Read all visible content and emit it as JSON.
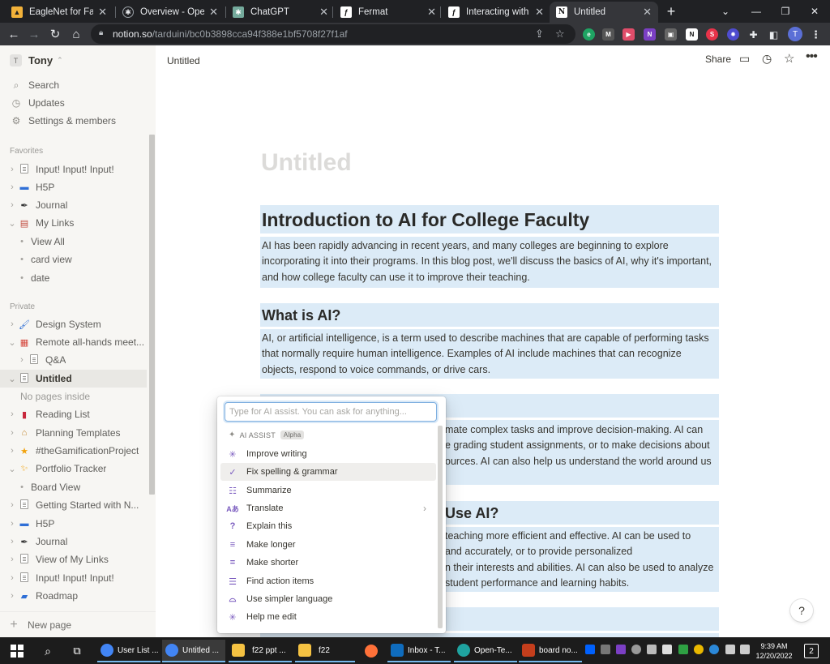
{
  "browser": {
    "tabs": [
      {
        "title": "EagleNet for Facult",
        "icon": "eaglenet-icon",
        "color": "#f2b23a"
      },
      {
        "title": "Overview - OpenAI",
        "icon": "openai-icon",
        "color": "#ffffff"
      },
      {
        "title": "ChatGPT",
        "icon": "chatgpt-icon",
        "color": "#74aa9c"
      },
      {
        "title": "Fermat",
        "icon": "fermat-icon",
        "color": "#ffffff"
      },
      {
        "title": "Interacting with AI",
        "icon": "fermat-icon",
        "color": "#ffffff"
      },
      {
        "title": "Untitled",
        "icon": "notion-icon",
        "color": "#ffffff"
      }
    ],
    "url_host": "notion.so",
    "url_path": "/tarduini/bc0b3898cca94f388e1bf5708f27f1af",
    "profile_initial": "T"
  },
  "sidebar": {
    "workspace_initial": "T",
    "workspace_name": "Tony",
    "top": [
      {
        "label": "Search",
        "icon": "search-icon"
      },
      {
        "label": "Updates",
        "icon": "clock-icon"
      },
      {
        "label": "Settings & members",
        "icon": "gear-icon"
      }
    ],
    "favorites_label": "Favorites",
    "favorites": [
      {
        "label": "Input! Input! Input!",
        "icon": "page-icon",
        "arrow": ">"
      },
      {
        "label": "H5P",
        "icon": "laptop-icon",
        "arrow": ">"
      },
      {
        "label": "Journal",
        "icon": "pen-icon",
        "arrow": ">"
      },
      {
        "label": "My Links",
        "icon": "books-icon",
        "arrow": "v"
      },
      {
        "label": "View All",
        "icon": "bullet",
        "arrow": ""
      },
      {
        "label": "card view",
        "icon": "bullet",
        "arrow": ""
      },
      {
        "label": "date",
        "icon": "bullet",
        "arrow": ""
      }
    ],
    "private_label": "Private",
    "private": [
      {
        "label": "Design System",
        "icon": "paintbrush-icon",
        "arrow": ">"
      },
      {
        "label": "Remote all-hands meet...",
        "icon": "calendar-icon",
        "arrow": "v"
      },
      {
        "label": "Q&A",
        "icon": "page-icon",
        "arrow": ">"
      },
      {
        "label": "Untitled",
        "icon": "page-icon",
        "arrow": "v"
      },
      {
        "label": "No pages inside",
        "icon": "",
        "arrow": ""
      },
      {
        "label": "Reading List",
        "icon": "book-icon",
        "arrow": ">"
      },
      {
        "label": "Planning Templates",
        "icon": "house-icon",
        "arrow": ">"
      },
      {
        "label": "#theGamificationProject",
        "icon": "star-icon",
        "arrow": ">"
      },
      {
        "label": "Portfolio Tracker",
        "icon": "sparkle-icon",
        "arrow": "v"
      },
      {
        "label": "Board View",
        "icon": "bullet",
        "arrow": ""
      },
      {
        "label": "Getting Started with N...",
        "icon": "page-icon",
        "arrow": ">"
      },
      {
        "label": "H5P",
        "icon": "laptop-icon",
        "arrow": ">"
      },
      {
        "label": "Journal",
        "icon": "pen-icon",
        "arrow": ">"
      },
      {
        "label": "View of My Links",
        "icon": "page-icon",
        "arrow": ">"
      },
      {
        "label": "Input! Input! Input!",
        "icon": "page-icon",
        "arrow": ">"
      },
      {
        "label": "Roadmap",
        "icon": "car-icon",
        "arrow": ">"
      }
    ],
    "new_page": "New page"
  },
  "topbar": {
    "breadcrumb": "Untitled",
    "share": "Share"
  },
  "page": {
    "title_placeholder": "Untitled",
    "h1": "Introduction to AI for College Faculty",
    "p1": "AI has been rapidly advancing in recent years, and many colleges are beginning to explore incorporating it into their programs. In this blog post, we'll discuss the basics of AI, why it's important, and how college faculty can use it to improve their teaching.",
    "h2a": "What is AI?",
    "p2": "AI, or artificial intelligence, is a term used to describe machines that are capable of performing tasks that normally require human intelligence. Examples of AI include machines that can recognize objects, respond to voice commands, or drive cars.",
    "p3_l1": "mate complex tasks and improve decision-making. AI can",
    "p3_l2": "e grading student assignments, or to make decisions about",
    "p3_l3": "ources. AI can also help us understand the world around us",
    "h2c": "Use AI?",
    "p4_l1": "teaching more efficient and effective. AI can be used to",
    "p4_l2": "and accurately, or to provide personalized",
    "p4_l3": "n their interests and abilities. AI can also be used to analyze",
    "p4_l4": "student performance and learning habits."
  },
  "ai_menu": {
    "placeholder": "Type for AI assist. You can ask for anything...",
    "header": "AI ASSIST",
    "badge": "Alpha",
    "items": [
      {
        "label": "Improve writing",
        "icon": "sparkle-icon"
      },
      {
        "label": "Fix spelling & grammar",
        "icon": "check-icon"
      },
      {
        "label": "Summarize",
        "icon": "summarize-icon"
      },
      {
        "label": "Translate",
        "icon": "translate-icon"
      },
      {
        "label": "Explain this",
        "icon": "question-icon"
      },
      {
        "label": "Make longer",
        "icon": "lines-long-icon"
      },
      {
        "label": "Make shorter",
        "icon": "lines-short-icon"
      },
      {
        "label": "Find action items",
        "icon": "checklist-icon"
      },
      {
        "label": "Use simpler language",
        "icon": "feather-icon"
      },
      {
        "label": "Help me edit",
        "icon": "sparkle-icon"
      }
    ]
  },
  "help": "?",
  "taskbar": {
    "items": [
      {
        "label": "User List ...",
        "icon": "chrome-icon",
        "color": "#4285f4"
      },
      {
        "label": "Untitled ...",
        "icon": "chrome-icon",
        "color": "#4285f4"
      },
      {
        "label": "f22 ppt ...",
        "icon": "folder-icon",
        "color": "#f5c242"
      },
      {
        "label": "f22",
        "icon": "folder-icon",
        "color": "#f5c242"
      },
      {
        "label": "",
        "icon": "firefox-icon",
        "color": "#ff7139"
      },
      {
        "label": "Inbox - T...",
        "icon": "outlook-icon",
        "color": "#0f6cbd"
      },
      {
        "label": "Open-Te...",
        "icon": "edge-icon",
        "color": "#1fa3a0"
      },
      {
        "label": "board no...",
        "icon": "powerpoint-icon",
        "color": "#c43e1c"
      }
    ],
    "time": "9:39 AM",
    "date": "12/20/2022",
    "notifications": "2"
  }
}
